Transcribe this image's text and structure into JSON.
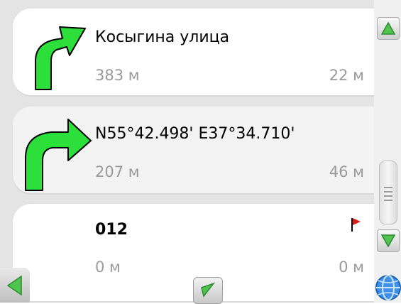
{
  "route": {
    "items": [
      {
        "title": "Косыгина улица",
        "distance": "383 м",
        "time": "22 м",
        "icon": "turn-right-arrow-icon"
      },
      {
        "title": "N55°42.498' E37°34.710'",
        "distance": "207 м",
        "time": "46 м",
        "icon": "turn-right-arrow-icon"
      },
      {
        "title": "012",
        "distance": "0 м",
        "time": "0 м",
        "icon": "destination-flag-icon"
      }
    ]
  },
  "colors": {
    "arrow_green": "#2ddf3b",
    "flag_red": "#d81a1a",
    "list_bg": "#e4e4e4",
    "secondary_text": "#9a9a9a"
  },
  "controls": {
    "scroll_up_icon": "triangle-up-icon",
    "scroll_down_icon": "triangle-down-icon",
    "back_icon": "triangle-left-icon",
    "mid_icon": "checkmark-triangle-icon",
    "globe_icon": "globe-icon"
  }
}
